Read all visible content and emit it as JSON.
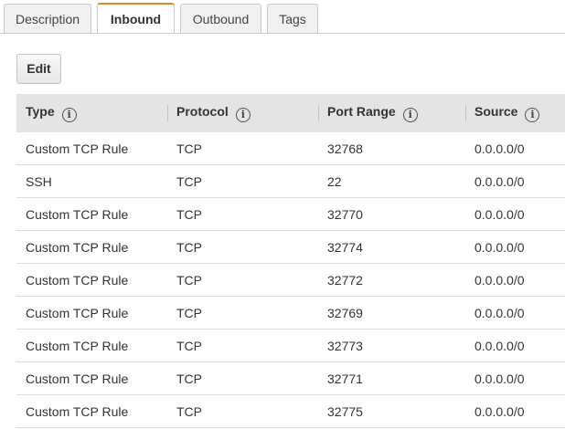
{
  "tabs": [
    {
      "label": "Description",
      "active": false
    },
    {
      "label": "Inbound",
      "active": true
    },
    {
      "label": "Outbound",
      "active": false
    },
    {
      "label": "Tags",
      "active": false
    }
  ],
  "colors": {
    "active_tab_accent": "#e28a1c",
    "header_bg": "#e4e4e4"
  },
  "edit_button": {
    "label": "Edit"
  },
  "table": {
    "columns": [
      {
        "label": "Type",
        "info_icon": "info-icon"
      },
      {
        "label": "Protocol",
        "info_icon": "info-icon"
      },
      {
        "label": "Port Range",
        "info_icon": "info-icon"
      },
      {
        "label": "Source",
        "info_icon": "info-icon"
      }
    ],
    "rows": [
      {
        "type": "Custom TCP Rule",
        "protocol": "TCP",
        "port_range": "32768",
        "source": "0.0.0.0/0"
      },
      {
        "type": "SSH",
        "protocol": "TCP",
        "port_range": "22",
        "source": "0.0.0.0/0"
      },
      {
        "type": "Custom TCP Rule",
        "protocol": "TCP",
        "port_range": "32770",
        "source": "0.0.0.0/0"
      },
      {
        "type": "Custom TCP Rule",
        "protocol": "TCP",
        "port_range": "32774",
        "source": "0.0.0.0/0"
      },
      {
        "type": "Custom TCP Rule",
        "protocol": "TCP",
        "port_range": "32772",
        "source": "0.0.0.0/0"
      },
      {
        "type": "Custom TCP Rule",
        "protocol": "TCP",
        "port_range": "32769",
        "source": "0.0.0.0/0"
      },
      {
        "type": "Custom TCP Rule",
        "protocol": "TCP",
        "port_range": "32773",
        "source": "0.0.0.0/0"
      },
      {
        "type": "Custom TCP Rule",
        "protocol": "TCP",
        "port_range": "32771",
        "source": "0.0.0.0/0"
      },
      {
        "type": "Custom TCP Rule",
        "protocol": "TCP",
        "port_range": "32775",
        "source": "0.0.0.0/0"
      }
    ]
  }
}
